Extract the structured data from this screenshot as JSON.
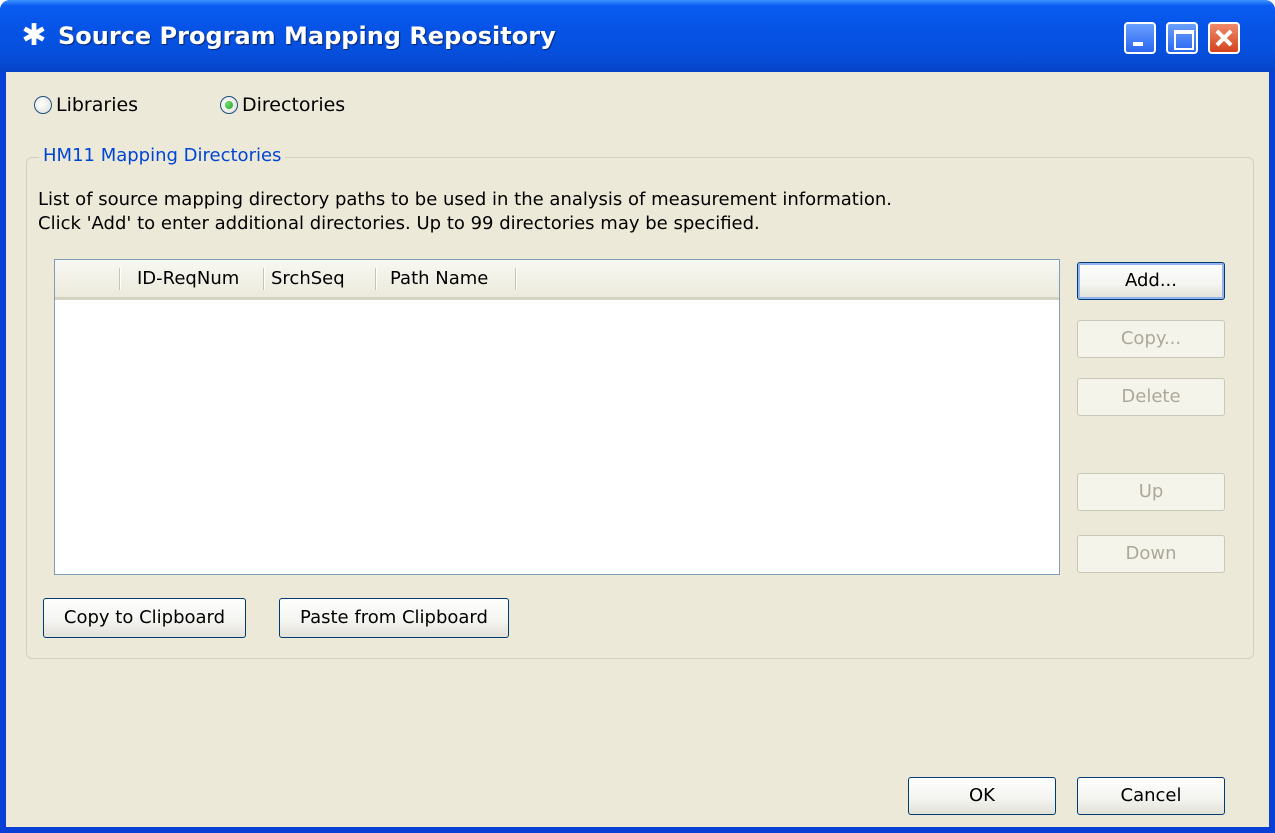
{
  "window": {
    "title": "Source Program Mapping Repository",
    "icon": "asterisk-app-icon"
  },
  "source_type": {
    "options": [
      {
        "label": "Libraries",
        "selected": false
      },
      {
        "label": "Directories",
        "selected": true
      }
    ]
  },
  "group": {
    "legend": "HM11 Mapping Directories",
    "description_line1": "List of source mapping directory paths to be used in the analysis of measurement information.",
    "description_line2": "Click 'Add' to enter additional directories.  Up to 99 directories may be specified."
  },
  "table": {
    "columns": [
      "",
      "ID-ReqNum",
      "SrchSeq",
      "Path Name"
    ],
    "rows": []
  },
  "side_buttons": {
    "add": "Add...",
    "copy": "Copy...",
    "delete": "Delete",
    "up": "Up",
    "down": "Down"
  },
  "clipboard": {
    "copy": "Copy to Clipboard",
    "paste": "Paste from Clipboard"
  },
  "dialog_buttons": {
    "ok": "OK",
    "cancel": "Cancel"
  }
}
